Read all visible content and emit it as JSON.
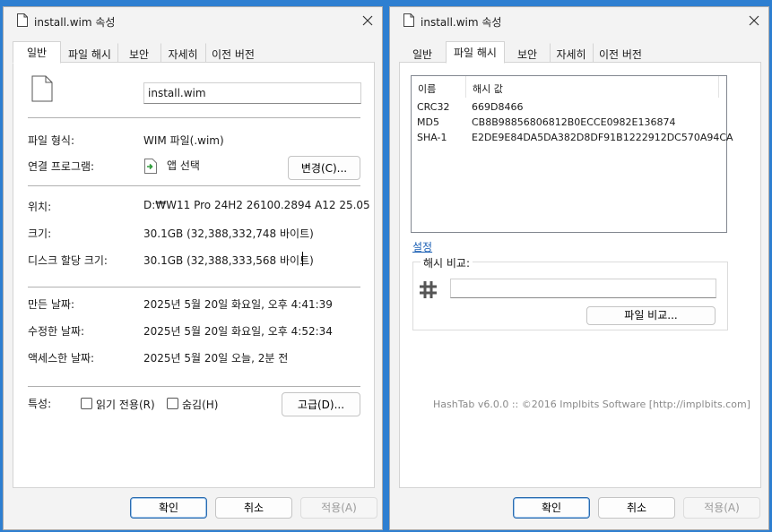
{
  "colors": {
    "desktop": "#2e7fd1",
    "window_bg": "#f3f3f3",
    "link": "#1a5fb4",
    "footer_text": "#8a8a8a"
  },
  "window_left": {
    "title": "install.wim 속성",
    "title_icon": "file-icon",
    "tabs": [
      "일반",
      "파일 해시",
      "보안",
      "자세히",
      "이전 버전"
    ],
    "filename": "install.wim",
    "file_type_label": "파일 형식:",
    "file_type_value": "WIM 파일(.wim)",
    "opens_with_label": "연결 프로그램:",
    "opens_with_value": "앱 선택",
    "change_button": "변경(C)...",
    "location_label": "위치:",
    "location_value": "D:₩W11 Pro 24H2 26100.2894 A12 25.05",
    "size_label": "크기:",
    "size_value": "30.1GB (32,388,332,748 바이트)",
    "size_on_disk_label": "디스크 할당 크기:",
    "size_on_disk_value": "30.1GB (32,388,333,568 바이트)",
    "created_label": "만든 날짜:",
    "created_value": "2025년 5월 20일 화요일, 오후 4:41:39",
    "modified_label": "수정한 날짜:",
    "modified_value": "2025년 5월 20일 화요일, 오후 4:52:34",
    "accessed_label": "액세스한 날짜:",
    "accessed_value": "2025년 5월 20일 오늘, 2분 전",
    "attributes_label": "특성:",
    "readonly_label": "읽기 전용(R)",
    "readonly_checked": false,
    "hidden_label": "숨김(H)",
    "hidden_checked": false,
    "advanced_button": "고급(D)...",
    "ok_button": "확인",
    "cancel_button": "취소",
    "apply_button": "적용(A)"
  },
  "window_right": {
    "title": "install.wim 속성",
    "title_icon": "file-icon",
    "tabs": [
      "일반",
      "파일 해시",
      "보안",
      "자세히",
      "이전 버전"
    ],
    "col_name": "이름",
    "col_hash": "해시 값",
    "rows": [
      {
        "name": "CRC32",
        "value": "669D8466"
      },
      {
        "name": "MD5",
        "value": "CB8B98856806812B0ECCE0982E136874"
      },
      {
        "name": "SHA-1",
        "value": "E2DE9E84DA5DA382D8DF91B1222912DC570A94CA"
      }
    ],
    "settings_link": "설정",
    "compare_group_label": "해시 비교:",
    "compare_icon": "hash-icon",
    "compare_input_value": "",
    "compare_file_button": "파일 비교...",
    "footer": "HashTab v6.0.0 :: ©2016 Implbits Software [http://implbits.com]",
    "ok_button": "확인",
    "cancel_button": "취소",
    "apply_button": "적용(A)"
  }
}
